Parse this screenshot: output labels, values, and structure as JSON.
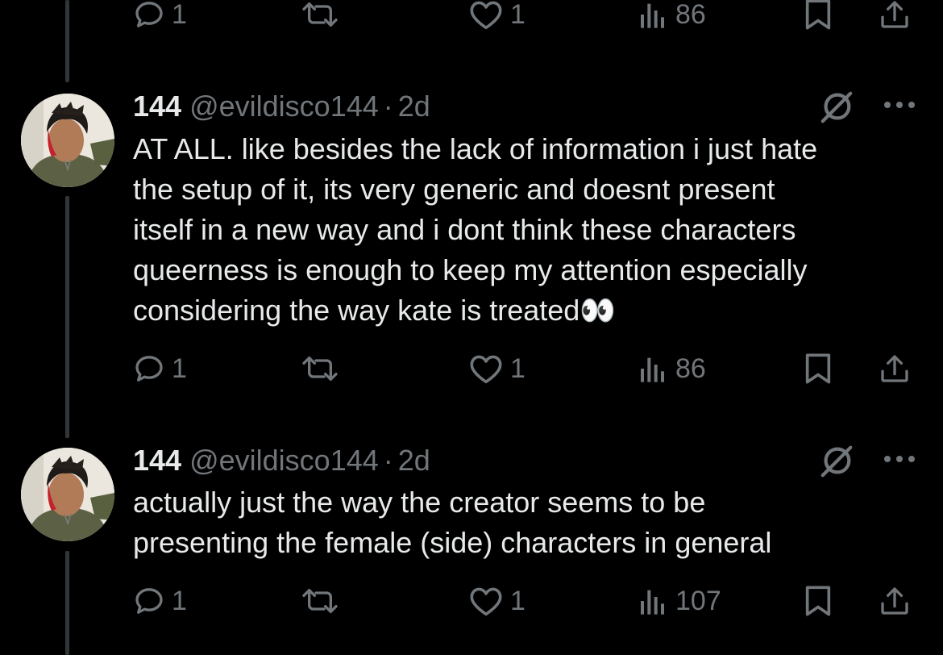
{
  "theme": {
    "background": "#000000",
    "text_primary": "#e7e9ea",
    "text_secondary": "#71767b",
    "thread_line": "#333639"
  },
  "top_actions": {
    "replies": "1",
    "likes": "1",
    "views": "86"
  },
  "tweets": [
    {
      "name": "144",
      "handle": "@evildisco144",
      "separator": "·",
      "time": "2d",
      "text": "AT ALL. like besides the lack of information i just hate\nthe setup of it, its very generic and doesnt present\nitself in a new way and i dont think these characters\nqueerness is enough to keep my attention especially\nconsidering the way kate is treated👀",
      "replies": "1",
      "likes": "1",
      "views": "86"
    },
    {
      "name": "144",
      "handle": "@evildisco144",
      "separator": "·",
      "time": "2d",
      "text": "actually just the way the creator seems to be\npresenting the female (side) characters in general",
      "replies": "1",
      "likes": "1",
      "views": "107"
    }
  ],
  "icons": {
    "reply": "reply-icon",
    "retweet": "retweet-icon",
    "like": "like-icon",
    "views": "views-icon",
    "bookmark": "bookmark-icon",
    "share": "share-icon",
    "grok": "grok-icon",
    "more": "more-icon"
  }
}
